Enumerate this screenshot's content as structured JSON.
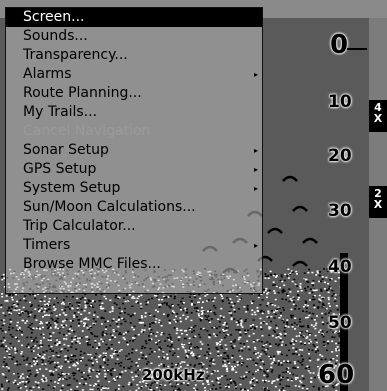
{
  "menu": {
    "items": [
      {
        "label": "Screen...",
        "selected": true,
        "disabled": false,
        "submenu": false
      },
      {
        "label": "Sounds...",
        "selected": false,
        "disabled": false,
        "submenu": false
      },
      {
        "label": "Transparency...",
        "selected": false,
        "disabled": false,
        "submenu": false
      },
      {
        "label": "Alarms",
        "selected": false,
        "disabled": false,
        "submenu": true
      },
      {
        "label": "Route Planning...",
        "selected": false,
        "disabled": false,
        "submenu": false
      },
      {
        "label": "My Trails...",
        "selected": false,
        "disabled": false,
        "submenu": false
      },
      {
        "label": "Cancel Navigation",
        "selected": false,
        "disabled": true,
        "submenu": false
      },
      {
        "label": "Sonar Setup",
        "selected": false,
        "disabled": false,
        "submenu": true
      },
      {
        "label": "GPS Setup",
        "selected": false,
        "disabled": false,
        "submenu": true
      },
      {
        "label": "System Setup",
        "selected": false,
        "disabled": false,
        "submenu": true
      },
      {
        "label": "Sun/Moon Calculations...",
        "selected": false,
        "disabled": false,
        "submenu": false
      },
      {
        "label": "Trip Calculator...",
        "selected": false,
        "disabled": false,
        "submenu": false
      },
      {
        "label": "Timers",
        "selected": false,
        "disabled": false,
        "submenu": true
      },
      {
        "label": "Browse MMC Files...",
        "selected": false,
        "disabled": false,
        "submenu": false
      }
    ],
    "submenu_arrow": "▸"
  },
  "sonar": {
    "depth_scale": [
      "0",
      "10",
      "20",
      "30",
      "40",
      "50",
      "60"
    ],
    "frequency": "200kHz",
    "zoom_markers": [
      "4X",
      "2X"
    ]
  },
  "colors": {
    "selected_bg": "#000000",
    "disabled_text": "#9a9a9a"
  }
}
